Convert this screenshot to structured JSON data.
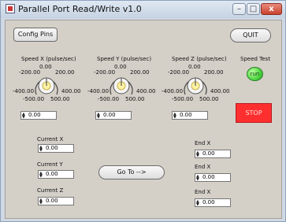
{
  "window": {
    "title": "Parallel Port Read/Write v1.0",
    "controls": {
      "minimize": "–",
      "maximize": "□",
      "close": "x"
    }
  },
  "buttons": {
    "config": "Config Pins",
    "quit": "QUIT",
    "goto": "Go To -->",
    "stop": "STOP"
  },
  "speeds": [
    {
      "label": "Speed X (pulse/sec)",
      "t0": "0.00",
      "tm200": "-200.00",
      "t200": "200.00",
      "tm400": "-400.00",
      "t400": "400.00",
      "tm500": "-500.00",
      "t500": "500.00",
      "value": "0.00"
    },
    {
      "label": "Speed Y (pulse/sec)",
      "t0": "0.00",
      "tm200": "-200.00",
      "t200": "200.00",
      "tm400": "-400.00",
      "t400": "400.00",
      "tm500": "-500.00",
      "t500": "500.00",
      "value": "0.00"
    },
    {
      "label": "Speed Z (pulse/sec)",
      "t0": "0.00",
      "tm200": "-200.00",
      "t200": "200.00",
      "tm400": "-400.00",
      "t400": "400.00",
      "tm500": "-500.00",
      "t500": "500.00",
      "value": "0.00"
    }
  ],
  "speed_test": {
    "label": "Speed Test",
    "indicator": "run"
  },
  "current": [
    {
      "label": "Current X",
      "value": "0.00"
    },
    {
      "label": "Current Y",
      "value": "0.00"
    },
    {
      "label": "Current Z",
      "value": "0.00"
    }
  ],
  "end": [
    {
      "label": "End X",
      "value": "0.00"
    },
    {
      "label": "End X",
      "value": "0.00"
    },
    {
      "label": "End X",
      "value": "0.00"
    }
  ],
  "colors": {
    "led": "#45d13a",
    "stop": "#ff2f2f"
  },
  "icons": {
    "spin": "spin-arrows-icon",
    "app": "app-icon"
  }
}
